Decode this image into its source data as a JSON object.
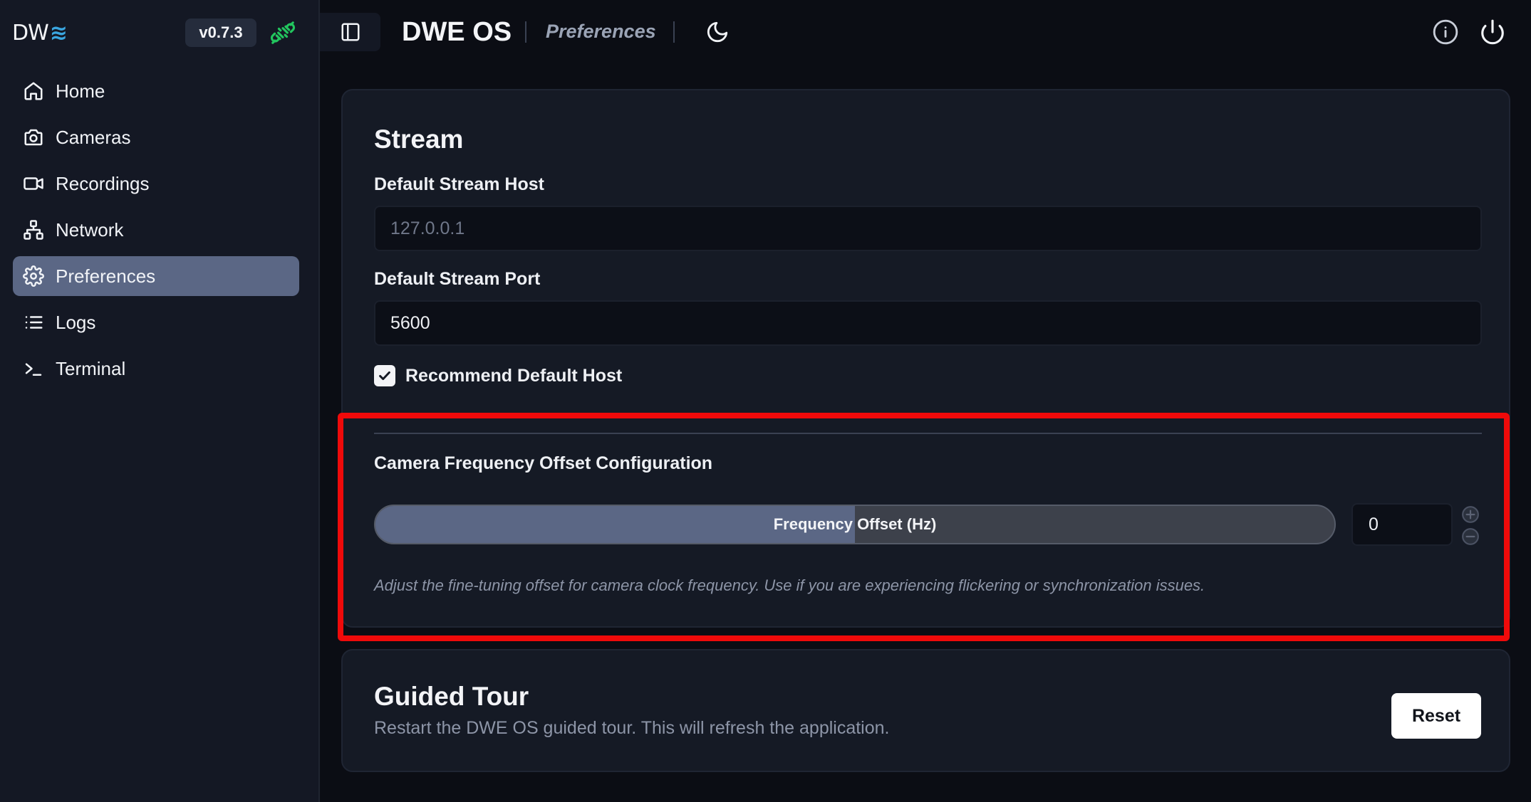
{
  "app": {
    "logo_text": "DW",
    "logo_wave": "≋",
    "version": "v0.7.3",
    "title": "DWE OS",
    "page_title": "Preferences"
  },
  "sidebar": {
    "items": [
      {
        "label": "Home",
        "icon": "home-icon",
        "active": false
      },
      {
        "label": "Cameras",
        "icon": "camera-icon",
        "active": false
      },
      {
        "label": "Recordings",
        "icon": "video-icon",
        "active": false
      },
      {
        "label": "Network",
        "icon": "network-icon",
        "active": false
      },
      {
        "label": "Preferences",
        "icon": "gear-icon",
        "active": true
      },
      {
        "label": "Logs",
        "icon": "list-icon",
        "active": false
      },
      {
        "label": "Terminal",
        "icon": "terminal-icon",
        "active": false
      }
    ]
  },
  "stream": {
    "heading": "Stream",
    "host_label": "Default Stream Host",
    "host_placeholder": "127.0.0.1",
    "port_label": "Default Stream Port",
    "port_value": "5600",
    "recommend_label": "Recommend Default Host",
    "recommend_checked": true
  },
  "frequency": {
    "heading": "Camera Frequency Offset Configuration",
    "slider_label": "Frequency Offset (Hz)",
    "slider_fraction": 0.5,
    "value": "0",
    "help": "Adjust the fine-tuning offset for camera clock frequency. Use if you are experiencing flickering or synchronization issues."
  },
  "tour": {
    "heading": "Guided Tour",
    "description": "Restart the DWE OS guided tour. This will refresh the application.",
    "reset_label": "Reset"
  },
  "colors": {
    "accent": "#5b6785",
    "connected": "#22c55e",
    "highlight": "#ef0a0a",
    "logo_wave": "#3aa6e0"
  }
}
